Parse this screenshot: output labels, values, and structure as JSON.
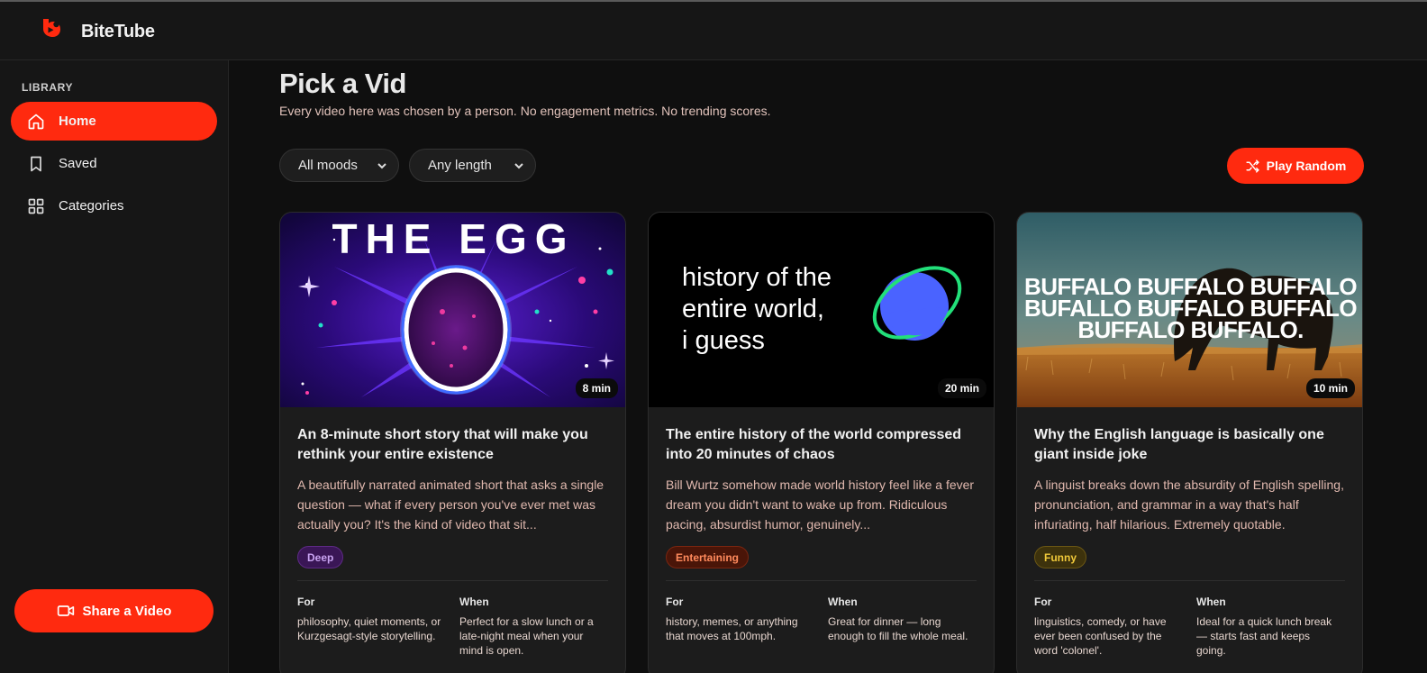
{
  "app": {
    "name": "BiteTube",
    "accent": "#ff2a0f"
  },
  "sidebar": {
    "section_label": "LIBRARY",
    "items": [
      {
        "label": "Home",
        "icon": "home-icon",
        "active": true
      },
      {
        "label": "Saved",
        "icon": "bookmark-icon",
        "active": false
      },
      {
        "label": "Categories",
        "icon": "grid-icon",
        "active": false
      }
    ],
    "share_label": "Share a Video"
  },
  "main": {
    "title": "Pick a Vid",
    "subtitle": "Every video here was chosen by a person. No engagement metrics. No trending scores.",
    "filters": {
      "mood": "All moods",
      "length": "Any length"
    },
    "play_random_label": "Play Random"
  },
  "cards": [
    {
      "thumb_text": "THE EGG",
      "duration": "8 min",
      "title": "An 8-minute short story that will make you rethink your entire existence",
      "description": "A beautifully narrated animated short that asks a single question — what if every person you've ever met was actually you? It's the kind of video that sit...",
      "tag": "Deep",
      "tag_color": "#b67ee8",
      "for_label": "For",
      "for_value": "philosophy, quiet moments, or Kurzgesagt-style storytelling.",
      "when_label": "When",
      "when_value": "Perfect for a slow lunch or a late-night meal when your mind is open."
    },
    {
      "thumb_lines": [
        "history of the",
        "entire world,",
        "i guess"
      ],
      "duration": "20 min",
      "title": "The entire history of the world compressed into 20 minutes of chaos",
      "description": "Bill Wurtz somehow made world history feel like a fever dream you didn't want to wake up from. Ridiculous pacing, absurdist humor, genuinely...",
      "tag": "Entertaining",
      "tag_color": "#ff7a4d",
      "for_label": "For",
      "for_value": "history, memes, or anything that moves at 100mph.",
      "when_label": "When",
      "when_value": "Great for dinner — long enough to fill the whole meal."
    },
    {
      "thumb_lines": [
        "BUFFALO BUFFALO BUFFALO",
        "BUFALLO BUFFALO BUFFALO",
        "BUFFALO BUFFALO."
      ],
      "duration": "10 min",
      "title": "Why the English language is basically one giant inside joke",
      "description": "A linguist breaks down the absurdity of English spelling, pronunciation, and grammar in a way that's half infuriating, half hilarious. Extremely quotable.",
      "tag": "Funny",
      "tag_color": "#e6c23a",
      "for_label": "For",
      "for_value": "linguistics, comedy, or have ever been confused by the word 'colonel'.",
      "when_label": "When",
      "when_value": "Ideal for a quick lunch break — starts fast and keeps going."
    }
  ]
}
